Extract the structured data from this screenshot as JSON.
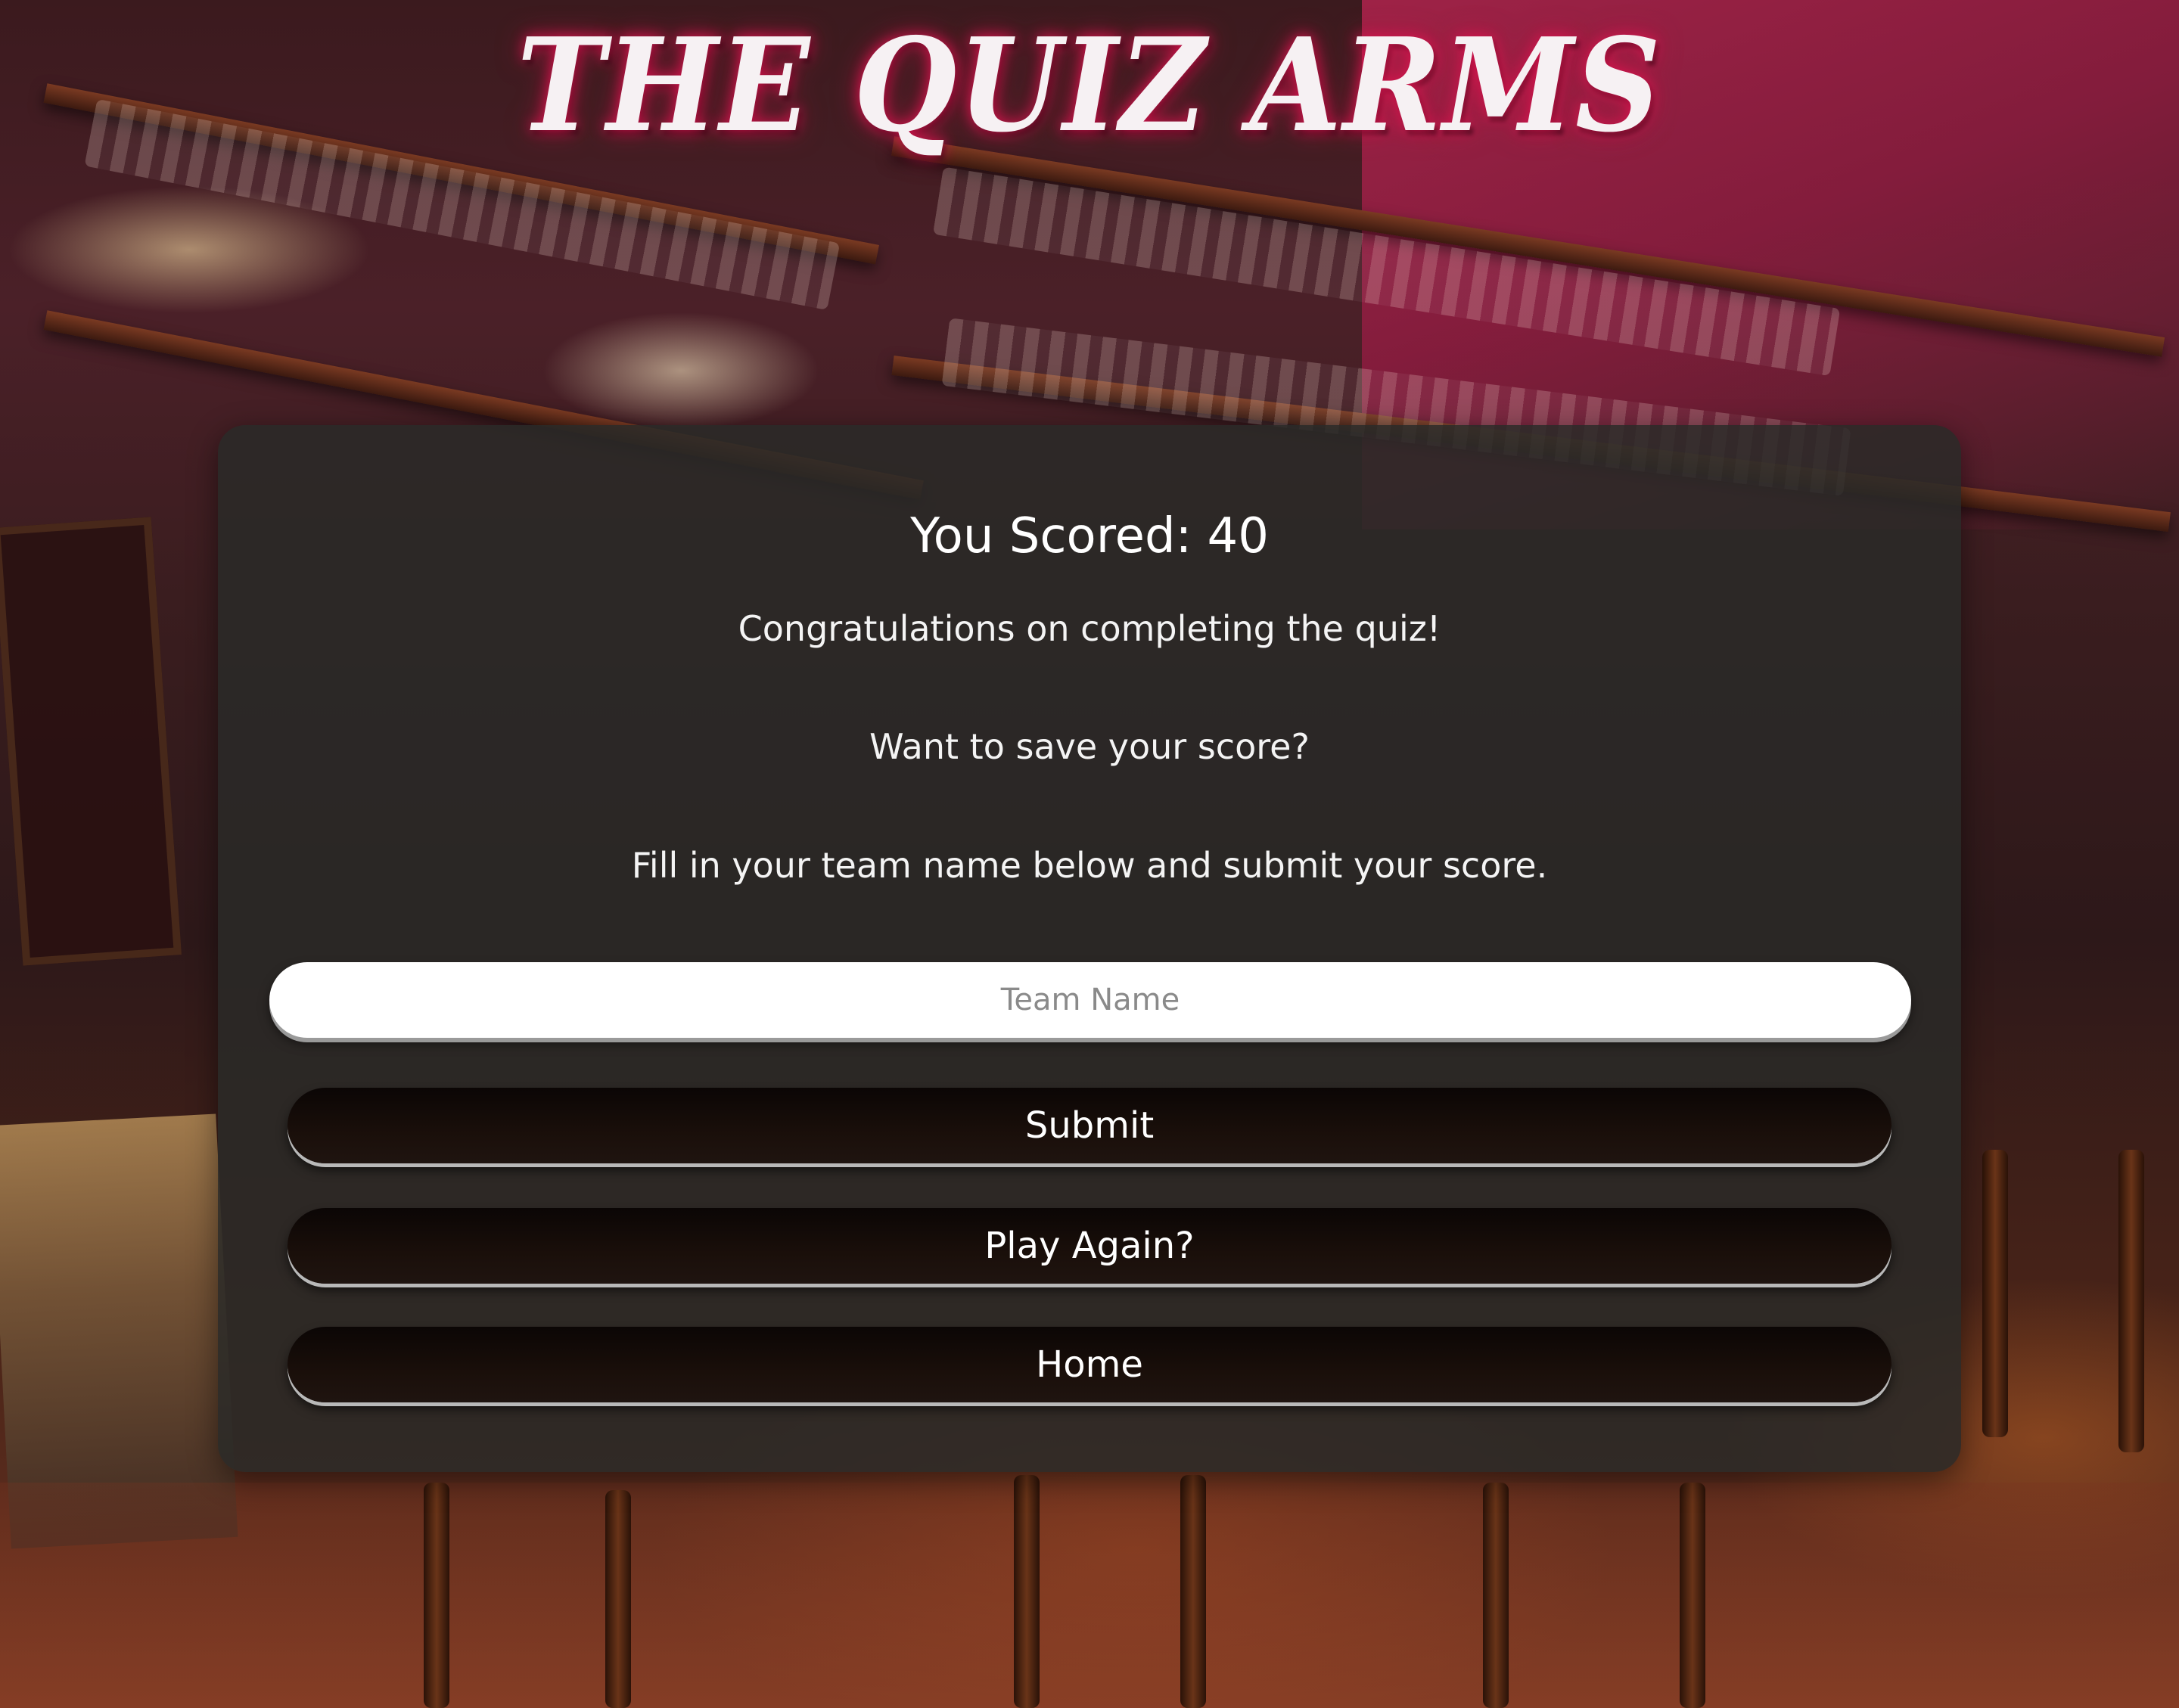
{
  "header": {
    "title": "THE QUIZ ARMS"
  },
  "results": {
    "score_text": "You Scored: 40",
    "congrats": "Congratulations on completing the quiz!",
    "save_prompt": "Want to save your score?",
    "instructions": "Fill in your team name below and submit your score.",
    "team_input_placeholder": "Team Name",
    "team_input_value": ""
  },
  "buttons": {
    "submit_label": "Submit",
    "play_again_label": "Play Again?",
    "home_label": "Home"
  },
  "colors": {
    "title_glow": "#dc1450",
    "card_background": "#2a2a28",
    "button_background": "#0b0605",
    "input_background": "#ffffff"
  }
}
